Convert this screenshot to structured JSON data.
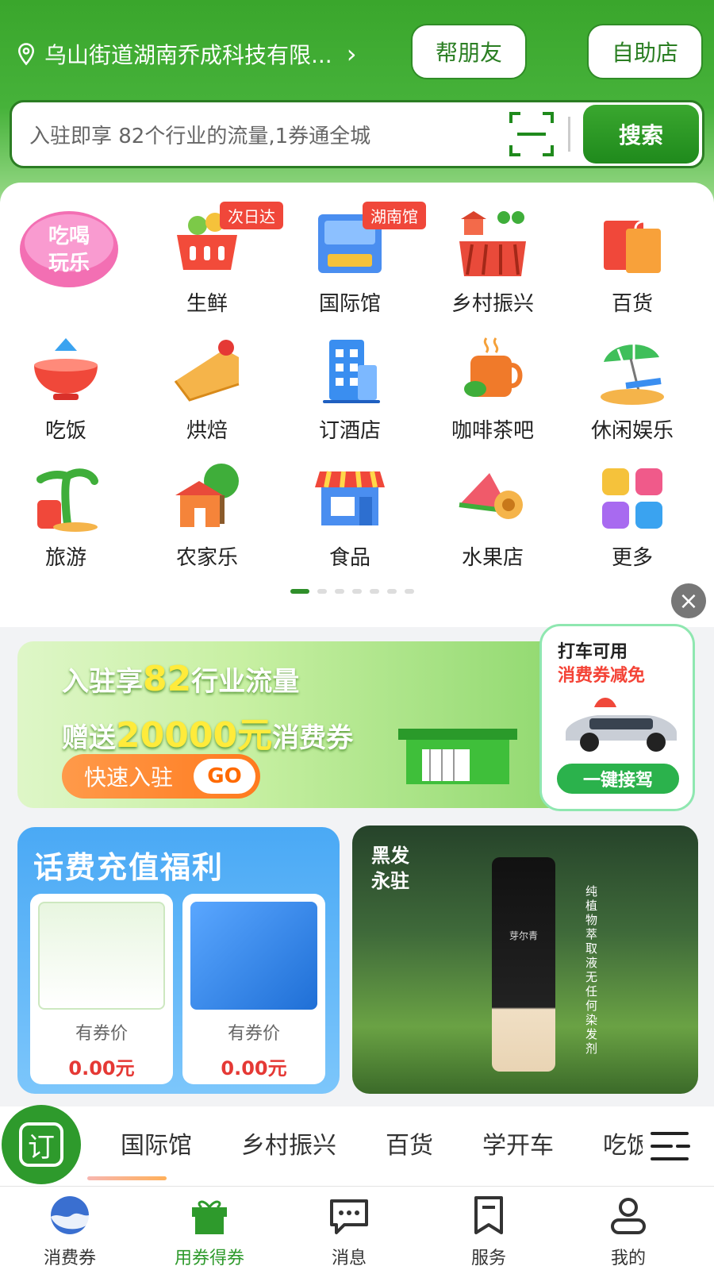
{
  "header": {
    "location": "乌山街道湖南乔成科技有限...",
    "friend_button": "帮朋友",
    "self_store_button": "自助店",
    "search_placeholder": "入驻即享 82个行业的流量,1券通全城",
    "search_button": "搜索"
  },
  "categories": [
    {
      "label": "吃喝玩乐",
      "icon": "eat-drink-play-icon"
    },
    {
      "label": "生鲜",
      "icon": "fresh-basket-icon",
      "tag": "次日达"
    },
    {
      "label": "国际馆",
      "icon": "international-hall-icon",
      "tag": "湖南馆"
    },
    {
      "label": "乡村振兴",
      "icon": "rural-revival-icon"
    },
    {
      "label": "百货",
      "icon": "shopping-bag-icon"
    },
    {
      "label": "吃饭",
      "icon": "bowl-icon"
    },
    {
      "label": "烘焙",
      "icon": "cake-icon"
    },
    {
      "label": "订酒店",
      "icon": "hotel-icon"
    },
    {
      "label": "咖啡茶吧",
      "icon": "coffee-icon"
    },
    {
      "label": "休闲娱乐",
      "icon": "beach-umbrella-icon"
    },
    {
      "label": "旅游",
      "icon": "travel-palm-icon"
    },
    {
      "label": "农家乐",
      "icon": "farmhouse-icon"
    },
    {
      "label": "食品",
      "icon": "food-store-icon"
    },
    {
      "label": "水果店",
      "icon": "watermelon-icon"
    },
    {
      "label": "更多",
      "icon": "more-grid-icon"
    }
  ],
  "banner": {
    "line1_prefix": "入驻享",
    "line1_num": "82",
    "line1_suffix": "行业流量",
    "line2_prefix": "赠送",
    "line2_num": "20000元",
    "line2_suffix": "消费券",
    "join_label": "快速入驻",
    "go_label": "GO"
  },
  "taxi": {
    "title": "打车可用",
    "subtitle": "消费券减免",
    "button": "一键接驾"
  },
  "phone_card": {
    "title": "话费充值福利",
    "products": [
      {
        "coupon_label": "有券价",
        "price": "0.00元"
      },
      {
        "coupon_label": "有券价",
        "price": "0.00元"
      }
    ]
  },
  "ad_card": {
    "headline": "黑发\n永驻",
    "vertical_text": "纯植物萃取液 无任何染发剂",
    "brand": "芽尔青"
  },
  "order_button": "订",
  "tabs": [
    "国际馆",
    "乡村振兴",
    "百货",
    "学开车",
    "吃饭"
  ],
  "nav": [
    {
      "label": "消费券",
      "icon": "coupon-icon"
    },
    {
      "label": "用券得券",
      "icon": "gift-icon",
      "active": true
    },
    {
      "label": "消息",
      "icon": "message-icon"
    },
    {
      "label": "服务",
      "icon": "service-bookmark-icon"
    },
    {
      "label": "我的",
      "icon": "profile-icon"
    }
  ],
  "colors": {
    "brand_green": "#2e9a2c",
    "price_red": "#e53935",
    "accent_orange": "#ff7a1e"
  }
}
